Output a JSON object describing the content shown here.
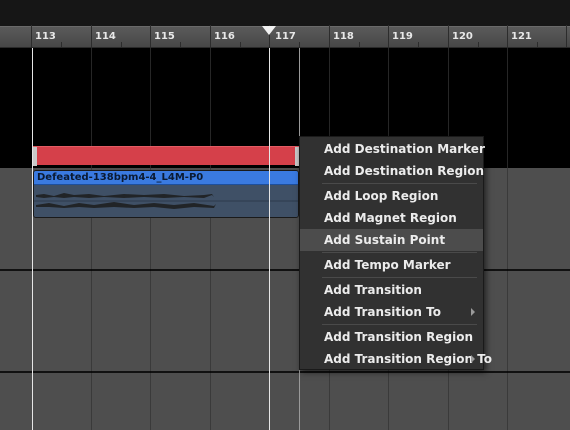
{
  "ruler": {
    "bars": [
      "113",
      "114",
      "115",
      "116",
      "117",
      "118",
      "119",
      "120",
      "121"
    ]
  },
  "clip": {
    "title": "Defeated-138bpm4-4_L4M-P0"
  },
  "context_menu": {
    "items": [
      {
        "label": "Add Destination Marker",
        "submenu": false
      },
      {
        "label": "Add Destination Region",
        "submenu": false
      },
      {
        "label": "Add Loop Region",
        "submenu": false
      },
      {
        "label": "Add Magnet Region",
        "submenu": false
      },
      {
        "label": "Add Sustain Point",
        "submenu": false,
        "highlighted": true
      },
      {
        "label": "Add Tempo Marker",
        "submenu": false
      },
      {
        "label": "Add Transition",
        "submenu": false
      },
      {
        "label": "Add Transition To",
        "submenu": true
      },
      {
        "label": "Add Transition Region",
        "submenu": false
      },
      {
        "label": "Add Transition Region To",
        "submenu": true
      }
    ]
  },
  "colors": {
    "region": "#d5404a",
    "clip_header": "#3a7ae0",
    "menu_bg": "#313131",
    "menu_highlight": "#4c4c4c"
  },
  "icons": {
    "playhead": "playhead-triangle-icon",
    "submenu": "submenu-arrow-icon"
  }
}
